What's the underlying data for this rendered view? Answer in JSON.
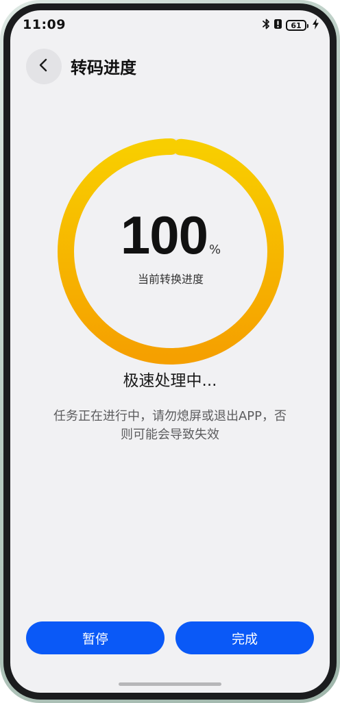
{
  "status_bar": {
    "time": "11:09",
    "battery_level": "61",
    "icons": [
      "bluetooth-icon",
      "vibrate-icon",
      "battery-icon",
      "charging-icon"
    ]
  },
  "header": {
    "back_icon": "chevron-left-icon",
    "title": "转码进度"
  },
  "progress": {
    "value": "100",
    "unit": "%",
    "caption": "当前转换进度",
    "fraction": 1.0,
    "ring_colors": {
      "start": "#f5a000",
      "end": "#f8ce00"
    }
  },
  "status": {
    "text": "极速处理中...",
    "hint": "任务正在进行中，请勿熄屏或退出APP，否则可能会导致失效"
  },
  "actions": {
    "pause_label": "暂停",
    "done_label": "完成",
    "button_color": "#0a59f7"
  }
}
